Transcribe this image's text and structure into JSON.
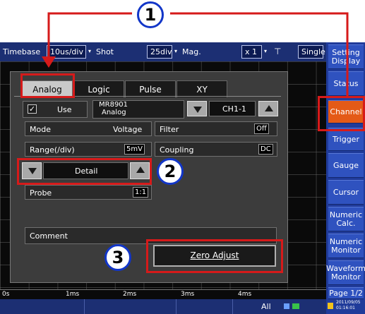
{
  "callouts": {
    "one": "1",
    "two": "2",
    "three": "3"
  },
  "topbar": {
    "timebase_label": "Timebase",
    "timebase_value": "10us/div",
    "shot_label": "Shot",
    "shot_value": "25div",
    "mag_label": "Mag.",
    "mag_value": "x 1",
    "mode_value": "Single"
  },
  "sidebar": {
    "items": [
      {
        "label": "Setting Display"
      },
      {
        "label": "Status"
      },
      {
        "label": "Channel"
      },
      {
        "label": "Trigger"
      },
      {
        "label": "Gauge"
      },
      {
        "label": "Cursor"
      },
      {
        "label": "Numeric Calc."
      },
      {
        "label": "Numeric Monitor"
      },
      {
        "label": "Waveform Monitor"
      },
      {
        "label": "Page 1/2"
      }
    ]
  },
  "tabs": [
    {
      "label": "Analog"
    },
    {
      "label": "Logic"
    },
    {
      "label": "Pulse"
    },
    {
      "label": "XY"
    }
  ],
  "channel": {
    "use_label": "Use",
    "use_checked": true,
    "module_name": "MR8901",
    "module_type": "Analog",
    "channel_value": "CH1-1"
  },
  "settings": {
    "mode_label": "Mode",
    "mode_value": "Voltage",
    "filter_label": "Filter",
    "filter_value": "Off",
    "range_label": "Range(/div)",
    "range_value": "5mV",
    "coupling_label": "Coupling",
    "coupling_value": "DC",
    "detail_label": "Detail",
    "probe_label": "Probe",
    "probe_value": "1:1",
    "comment_label": "Comment",
    "zero_adjust_label": "Zero Adjust"
  },
  "xaxis": {
    "ticks": [
      "0s",
      "1ms",
      "2ms",
      "3ms",
      "4ms"
    ]
  },
  "statusbar": {
    "all_label": "All",
    "timestamp": "2011/09/05 01:16:01"
  },
  "colors": {
    "highlight": "#d61a1a",
    "callout_border": "#1236c8",
    "active_sidebar": "#e45a17"
  }
}
